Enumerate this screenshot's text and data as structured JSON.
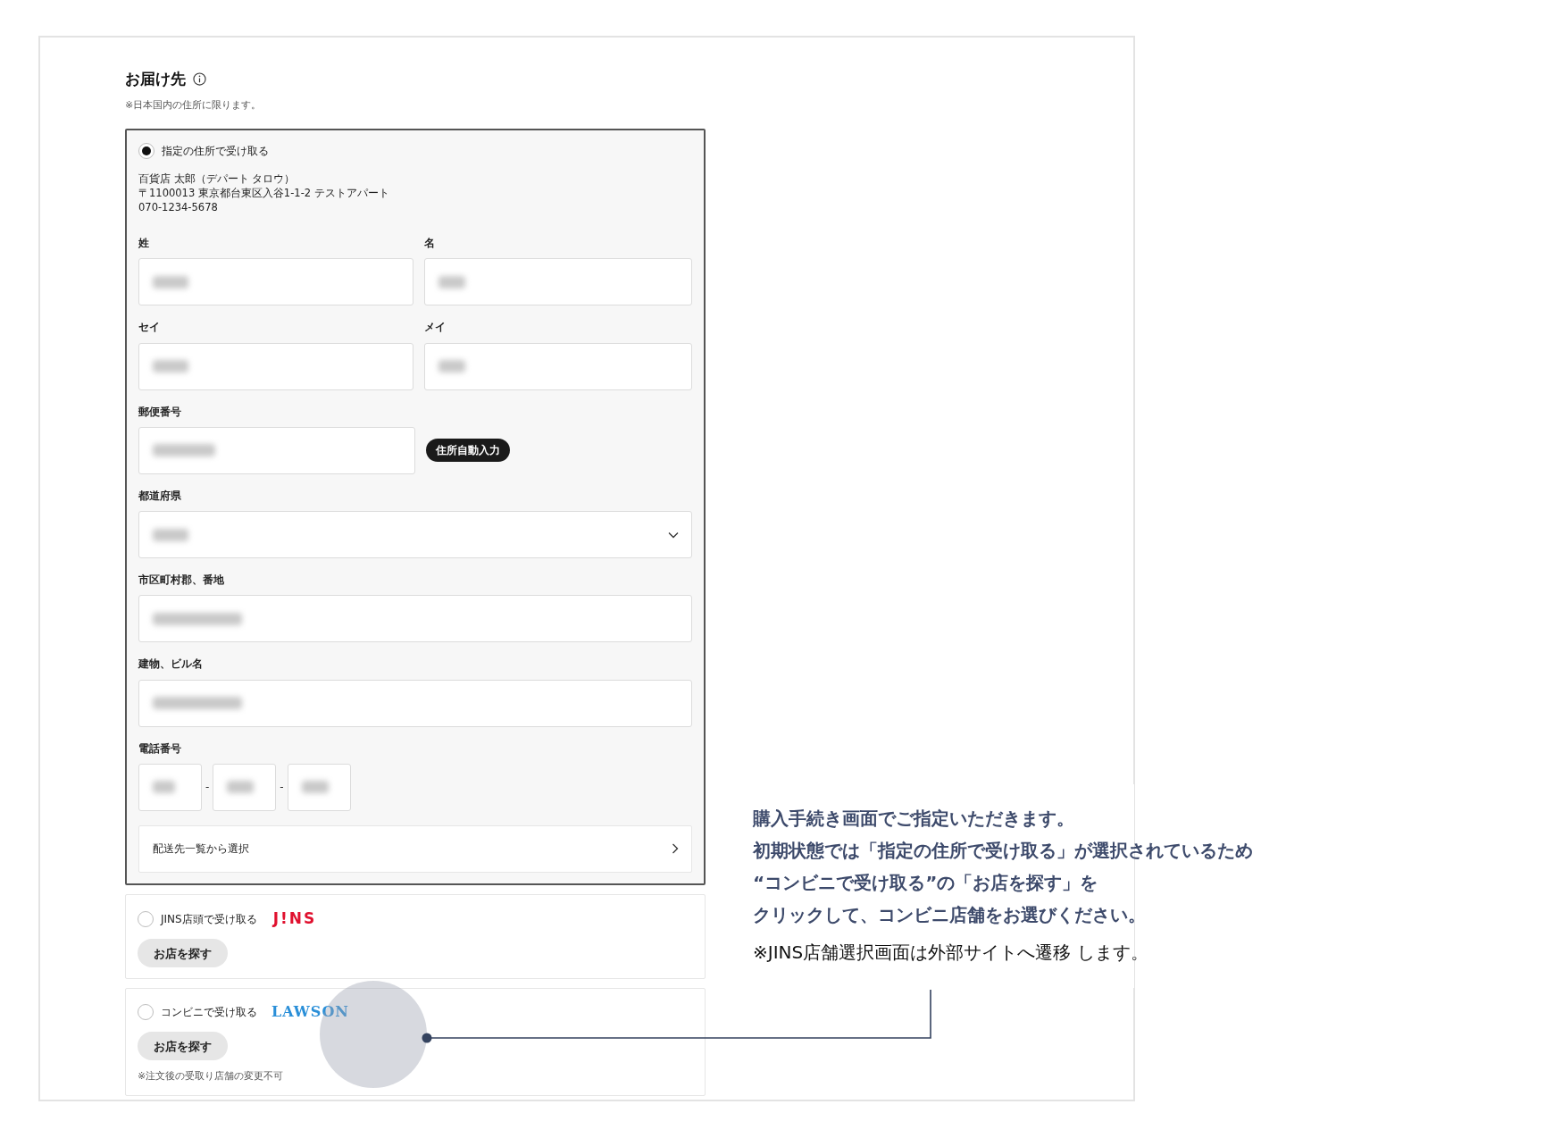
{
  "delivery": {
    "title": "お届け先",
    "note": "※日本国内の住所に限ります。",
    "options": [
      {
        "kind": "address",
        "label": "指定の住所で受け取る",
        "selected": true,
        "address_lines": [
          "百貨店 太郎（デパート タロウ）",
          "〒1100013 東京都台東区入谷1-1-2 テストアパート",
          "070-1234-5678"
        ],
        "fields": [
          {
            "kind": "pair",
            "items": [
              {
                "label": "姓"
              },
              {
                "label": "名"
              }
            ]
          },
          {
            "kind": "pair",
            "items": [
              {
                "label": "セイ"
              },
              {
                "label": "メイ"
              }
            ]
          },
          {
            "kind": "postal",
            "label": "郵便番号",
            "button": "住所自動入力"
          },
          {
            "kind": "select",
            "label": "都道府県"
          },
          {
            "kind": "full",
            "label": "市区町村郡、番地"
          },
          {
            "kind": "full",
            "label": "建物、ビル名"
          },
          {
            "kind": "phone",
            "label": "電話番号",
            "separators": [
              "-",
              "-"
            ]
          }
        ],
        "list_link": "配送先一覧から選択"
      },
      {
        "kind": "jins",
        "label": "JINS店頭で受け取る",
        "selected": false,
        "logo": "J!NS",
        "button": "お店を探す"
      },
      {
        "kind": "lawson",
        "label": "コンビニで受け取る",
        "selected": false,
        "logo": "LAWSON",
        "button": "お店を探す",
        "note": "※注文後の受取り店舗の変更不可"
      }
    ]
  },
  "callout": {
    "lines": [
      "購入手続き画面でご指定いただきます。",
      "初期状態では「指定の住所で受け取る」が選択されているため",
      "“コンビニで受け取る”の「お店を探す」を",
      "クリックして、コンビニ店舗をお選びください。"
    ],
    "note": "※JINS店舗選択画面は外部サイトへ遷移 します。"
  }
}
